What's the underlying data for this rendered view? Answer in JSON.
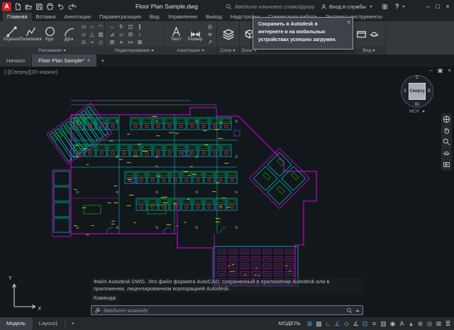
{
  "title_bar": {
    "logo_letter": "A",
    "title": "Floor Plan Sample.dwg",
    "search_placeholder": "Введите ключевое слово/фразу",
    "sign_in_label": "Вход в службы",
    "help_label": "?",
    "qat": [
      "new-file-icon",
      "open-file-icon",
      "save-icon",
      "plot-icon",
      "undo-icon",
      "redo-icon"
    ],
    "window": {
      "minimize": "–",
      "maximize": "□",
      "close": "×"
    }
  },
  "ribbon": {
    "tabs": [
      {
        "label": "Главная"
      },
      {
        "label": "Вставка"
      },
      {
        "label": "Аннотации"
      },
      {
        "label": "Параметризация"
      },
      {
        "label": "Вид"
      },
      {
        "label": "Управление"
      },
      {
        "label": "Вывод"
      },
      {
        "label": "Надстройки"
      },
      {
        "label": "Совместная работа"
      },
      {
        "label": "Экспресс-инструменты"
      }
    ],
    "panels": {
      "draw": {
        "title": "Рисование",
        "tools": [
          {
            "label": "Отрезок"
          },
          {
            "label": "Полилиния"
          },
          {
            "label": "Круг"
          },
          {
            "label": "Дуга"
          }
        ]
      },
      "modify": {
        "title": "Редактирование"
      },
      "annotate": {
        "title": "Аннотации",
        "tools": [
          {
            "label": "Текст"
          },
          {
            "label": "Размер"
          }
        ]
      },
      "layers": {
        "title": "Слои"
      },
      "block": {
        "title": "Блок"
      },
      "view": {
        "title": "Вид"
      }
    },
    "mini": {
      "draw_extra": [
        "▭",
        "○",
        "◠",
        "▱",
        "△",
        "▨",
        "⊙",
        "≈",
        "◇"
      ],
      "modify_grid": [
        "↔",
        "↻",
        "◫",
        "∥",
        "⊿",
        "▱",
        "⊟",
        "↕",
        "⊞",
        "≡",
        "↦",
        "⊠"
      ],
      "annotate_extra": [
        "◎",
        "≋",
        "↗"
      ]
    }
  },
  "notification": {
    "text": "Сохранить в Autodesk в интернете и на мобильных устройствах успешно загружен.",
    "close_glyph": "×"
  },
  "file_tabs": {
    "start": "Начало",
    "drawing": "Floor Plan Sample*",
    "close_glyph": "×",
    "new_tab": "+"
  },
  "viewport": {
    "controls_label": "[-][Сверху][2D-каркас]",
    "window": {
      "minimize": "–",
      "restore": "▣",
      "close": "×"
    },
    "viewcube": {
      "face": "Сверху",
      "north": "С",
      "south": "Ю",
      "east": "В",
      "west": "З",
      "ucs": "МСК"
    },
    "navbar": [
      "navigation-wheel-icon",
      "pan-icon",
      "zoom-icon",
      "orbit-icon",
      "showmotion-icon"
    ],
    "ucs_axis_x": "X",
    "ucs_axis_y": "Y"
  },
  "command": {
    "history_line": "Файл Autodesk DWG. Это файл формата AutoCAD, сохраненный в приложении Autodesk или в приложении, лицензированном корпорацией Autodesk.",
    "prompt1": "Команда:",
    "prompt2": "Команда:",
    "input_placeholder": "Введите команду"
  },
  "status_bar": {
    "model_tab": "Модель",
    "layout_tab": "Layout1",
    "new_layout": "+",
    "model_space_label": "МОДЕЛЬ",
    "icons": [
      {
        "name": "grid-icon",
        "glyph": "⊞",
        "active": true
      },
      {
        "name": "snap-icon",
        "glyph": "▦",
        "active": false
      },
      {
        "name": "ortho-icon",
        "glyph": "∟",
        "active": false
      },
      {
        "name": "polar-tracking-icon",
        "glyph": "∠",
        "active": true
      },
      {
        "name": "isodraft-icon",
        "glyph": "◇",
        "active": false
      },
      {
        "name": "osnap-tracking-icon",
        "glyph": "∡",
        "active": false
      },
      {
        "name": "osnap-icon",
        "glyph": "⊡",
        "active": true
      },
      {
        "name": "lineweight-icon",
        "glyph": "≡",
        "active": false
      },
      {
        "name": "transparency-icon",
        "glyph": "▥",
        "active": false
      },
      {
        "name": "selection-cycling-icon",
        "glyph": "◉",
        "active": false
      },
      {
        "name": "annotation-visibility-icon",
        "glyph": "А",
        "active": false
      },
      {
        "name": "autoscale-icon",
        "glyph": "▴",
        "active": false
      },
      {
        "name": "workspace-gear-icon",
        "glyph": "⊛",
        "active": false
      },
      {
        "name": "annotation-monitor-icon",
        "glyph": "◎",
        "active": false
      },
      {
        "name": "clean-screen-icon",
        "glyph": "⊠",
        "active": false
      },
      {
        "name": "customize-icon",
        "glyph": "≣",
        "active": false
      }
    ]
  },
  "colors": {
    "accent_blue": "#4da6e0",
    "cad_cyan": "#00dcdc",
    "cad_magenta": "#e000e0",
    "cad_green": "#00cc00",
    "cad_red": "#ff4545",
    "cad_yellow": "#e6e600"
  }
}
